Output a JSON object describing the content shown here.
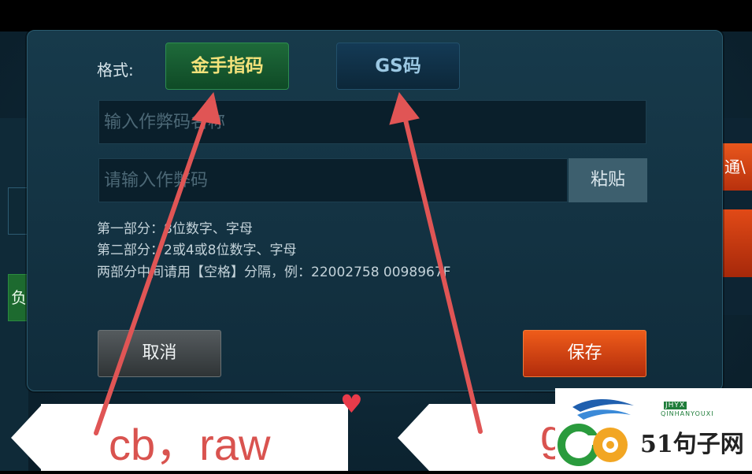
{
  "dialog": {
    "format_label": "格式:",
    "tabs": [
      {
        "label": "金手指码",
        "selected": true
      },
      {
        "label": "GS码",
        "selected": false
      }
    ],
    "name_input": {
      "placeholder": "输入作弊码名称"
    },
    "code_input": {
      "placeholder": "请输入作弊码"
    },
    "paste_label": "粘贴",
    "hints": [
      "第一部分：8位数字、字母",
      "第二部分：2或4或8位数字、字母",
      "两部分中间请用【空格】分隔，例：22002758 0098967F"
    ],
    "cancel_label": "取消",
    "save_label": "保存"
  },
  "background": {
    "right_button_label": "通\\",
    "left_button_label": "负"
  },
  "annotations": {
    "left_callout": "cb，raw",
    "right_callout": "g"
  },
  "watermark": {
    "site_name": "51句子网",
    "brand_tag": "JHYX",
    "brand_line": "QINHANYOUXI"
  },
  "colors": {
    "arrow": "#e05555",
    "accent_save": "#e2521a",
    "tab_selected_text": "#f3e27a"
  }
}
